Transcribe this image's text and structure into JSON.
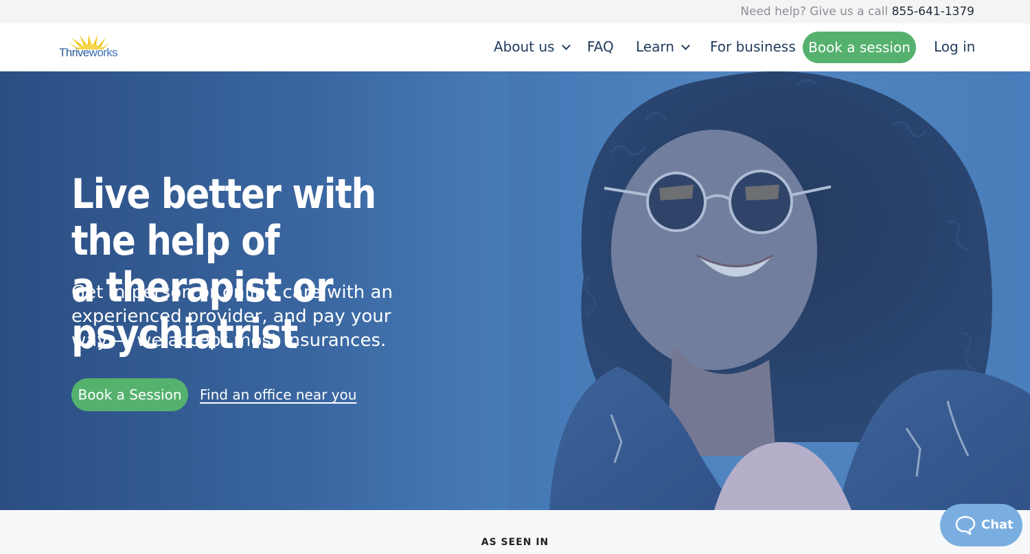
{
  "topbar": {
    "help_text": "Need help? Give us a call",
    "phone": "855-641-1379"
  },
  "logo": {
    "text_a": "Thrive",
    "text_b": "works"
  },
  "nav": {
    "items": [
      {
        "label": "About us"
      },
      {
        "label": "FAQ"
      },
      {
        "label": "Learn"
      },
      {
        "label": "For business"
      }
    ],
    "cta_label": "Book a session",
    "login_label": "Log in"
  },
  "hero": {
    "title_line1": "Live better with the help of",
    "title_line2": "a therapist or psychiatrist",
    "subtitle": "Get in-person or online care with an experienced provider, and pay your way — we accept most insurances.",
    "cta_label": "Book a Session",
    "link_label": "Find an office near you"
  },
  "seen_in": {
    "label": "AS SEEN IN"
  },
  "chat": {
    "label": "Chat"
  },
  "colors": {
    "accent_green": "#55b16e",
    "hero_blue": "#3a66a0",
    "chat_blue": "#7aaee0",
    "logo_yellow": "#f2c51d"
  }
}
